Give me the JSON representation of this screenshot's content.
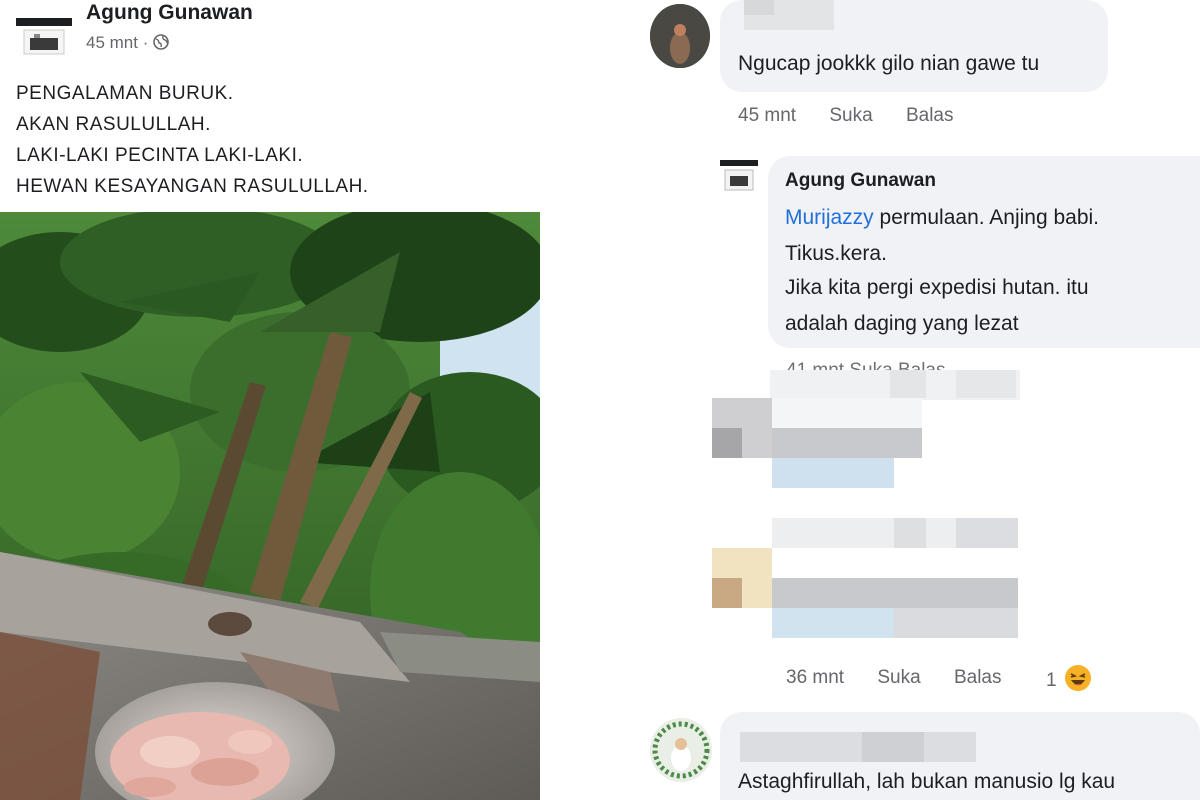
{
  "post": {
    "author": "Agung Gunawan",
    "time": "45 mnt",
    "lines": [
      "PENGALAMAN BURUK.",
      "AKAN RASULULLAH.",
      "LAKI-LAKI PECINTA LAKI-LAKI.",
      "HEWAN KESAYANGAN RASULULLAH."
    ]
  },
  "comments": {
    "c1": {
      "text": "Ngucap jookkk gilo nian gawe tu",
      "time": "45 mnt",
      "like": "Suka",
      "reply": "Balas"
    },
    "c2": {
      "author": "Agung Gunawan",
      "mention": "Murijazzy",
      "line1_rest": " permulaan. Anjing babi.",
      "line2": "Tikus.kera.",
      "line3": "Jika kita pergi expedisi hutan. itu",
      "line4": "adalah daging yang lezat",
      "meta_partial": "41 mnt  Suka  Balas"
    },
    "c4": {
      "time": "36 mnt",
      "like": "Suka",
      "reply": "Balas",
      "reaction_count": "1"
    },
    "c5": {
      "text": "Astaghfirullah, lah bukan manusio lg kau"
    }
  },
  "icons": {
    "globe": "globe-icon",
    "reaction": "laughing-emoji-icon"
  },
  "colors": {
    "bubble": "#f0f2f5",
    "mention": "#216fdb",
    "meta": "#65676b",
    "reaction": "#f7b125"
  }
}
